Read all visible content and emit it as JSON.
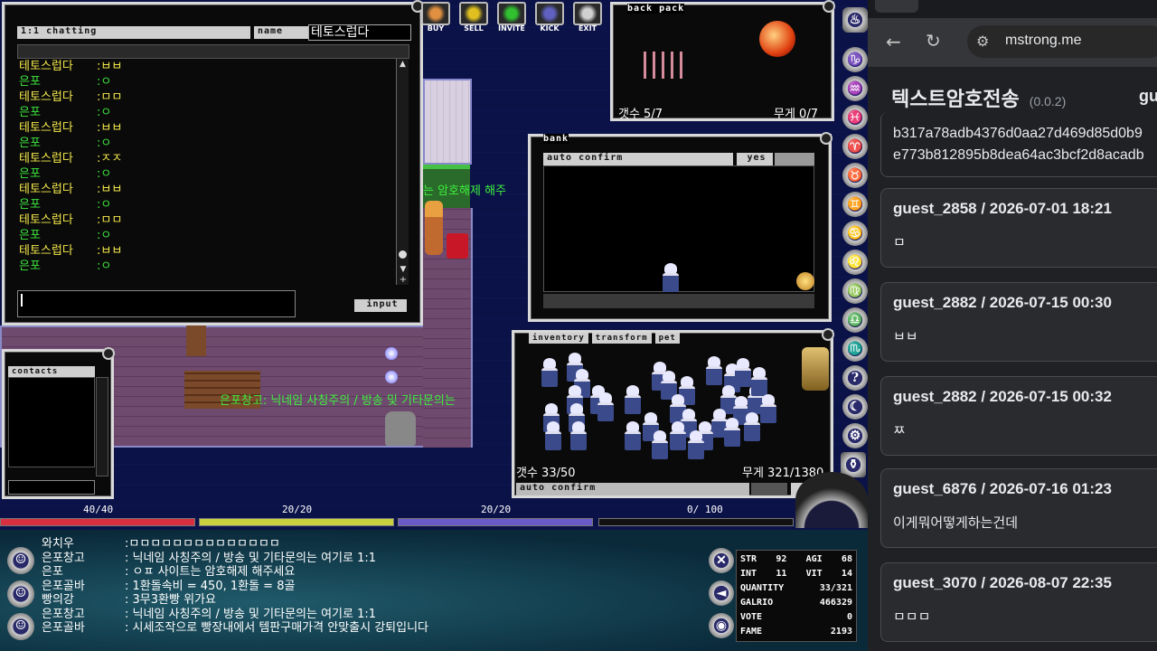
{
  "game": {
    "top_icons": [
      "BUY",
      "SELL",
      "INVITE",
      "KICK",
      "EXIT"
    ],
    "chat": {
      "title": "1:1 chatting",
      "name_label": "name",
      "name_value": "테토스럽다",
      "input_label": "input",
      "lines": [
        {
          "name": "테토스럽다",
          "msg": ":ㅂㅂ"
        },
        {
          "name": "은포",
          "msg": ":ㅇ"
        },
        {
          "name": "테토스럽다",
          "msg": ":ㅁㅁ"
        },
        {
          "name": "은포",
          "msg": ":ㅇ"
        },
        {
          "name": "테토스럽다",
          "msg": ":ㅂㅂ"
        },
        {
          "name": "은포",
          "msg": ":ㅇ"
        },
        {
          "name": "테토스럽다",
          "msg": ":ㅈㅈ"
        },
        {
          "name": "은포",
          "msg": ":ㅇ"
        },
        {
          "name": "테토스럽다",
          "msg": ":ㅂㅂ"
        },
        {
          "name": "은포",
          "msg": ":ㅇ"
        },
        {
          "name": "테토스럽다",
          "msg": ":ㅁㅁ"
        },
        {
          "name": "은포",
          "msg": ":ㅇ"
        },
        {
          "name": "테토스럽다",
          "msg": ":ㅂㅂ"
        },
        {
          "name": "은포",
          "msg": ":ㅇ"
        }
      ]
    },
    "backpack": {
      "title": "back pack",
      "count": "갯수 5/7",
      "weight": "무게 0/7"
    },
    "bank": {
      "title": "bank",
      "auto_confirm": "auto confirm",
      "yes": "yes"
    },
    "inventory": {
      "tabs": [
        "inventory",
        "transform",
        "pet"
      ],
      "count": "갯수 33/50",
      "weight": "무게 321/1380",
      "auto_confirm": "auto confirm",
      "no": "no"
    },
    "contacts": {
      "title": "contacts"
    },
    "world_text": {
      "npc_line": "는 암호해제 해주",
      "overhead": "은포창고: 닉네임 사칭주의 / 방송 및 기타문의는"
    },
    "bars": [
      {
        "label": "40/40",
        "color": "#d83040",
        "fill": 1.0
      },
      {
        "label": "20/20",
        "color": "#c8d040",
        "fill": 1.0
      },
      {
        "label": "20/20",
        "color": "#6a5ac8",
        "fill": 1.0
      },
      {
        "label": "0/ 100",
        "color": "#202020",
        "fill": 0.0
      }
    ],
    "system_messages": [
      {
        "name": "와치우",
        "msg": ":ㅁㅁㅁㅁㅁㅁㅁㅁㅁㅁㅁㅁㅁㅁ"
      },
      {
        "name": "은포창고",
        "msg": ": 닉네임 사칭주의 / 방송 및 기타문의는 여기로 1:1"
      },
      {
        "name": "은포",
        "msg": ": ㅇㅍ 사이트는 암호해제 해주세요"
      },
      {
        "name": "은포골바",
        "msg": ": 1환돌속비 = 450, 1환돌 = 8골"
      },
      {
        "name": "빵의강",
        "msg": ": 3무3환빵 위가요"
      },
      {
        "name": "은포창고",
        "msg": ": 닉네임 사칭주의 / 방송 및 기타문의는 여기로 1:1"
      },
      {
        "name": "은포골바",
        "msg": ": 시세조작으로 빵장내에서 템판구매가격 안맞출시 강퇴입니다"
      }
    ],
    "stats": [
      {
        "k": "STR",
        "v": "92",
        "k2": "AGI",
        "v2": "68"
      },
      {
        "k": "INT",
        "v": "11",
        "k2": "VIT",
        "v2": "14"
      },
      {
        "k": "QUANTITY",
        "v": "33/321"
      },
      {
        "k": "GALRIO",
        "v": "466329"
      },
      {
        "k": "VOTE",
        "v": "0"
      },
      {
        "k": "FAME",
        "v": "2193"
      }
    ]
  },
  "browser": {
    "url": "mstrong.me",
    "title": "텍스트암호전송",
    "version": "(0.0.2)",
    "title_extra": "gu",
    "hash_lines": [
      "b317a78adb4376d0aa27d469d85d0b9",
      "e773b812895b8dea64ac3bcf2d8acadb"
    ],
    "messages": [
      {
        "header": "guest_2858 / 2026-07-01 18:21",
        "body": "ㅁ"
      },
      {
        "header": "guest_2882 / 2026-07-15 00:30",
        "body": "ㅂㅂ"
      },
      {
        "header": "guest_2882 / 2026-07-15 00:32",
        "body": "ㅉ"
      },
      {
        "header": "guest_6876 / 2026-07-16 01:23",
        "body": "이게뭐어떻게하는건데"
      },
      {
        "header": "guest_3070 / 2026-08-07 22:35",
        "body": "ㅁㅁㅁ"
      }
    ]
  }
}
